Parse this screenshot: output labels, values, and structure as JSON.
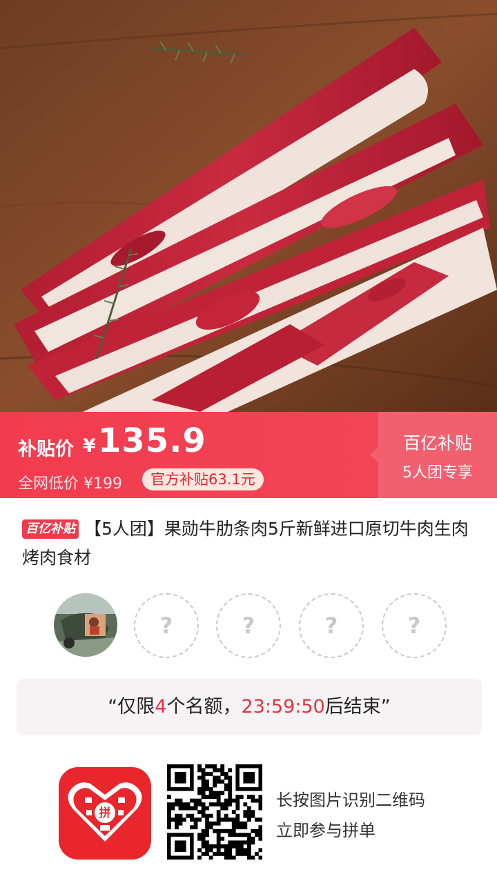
{
  "price_bar": {
    "label": "补贴价",
    "currency": "¥",
    "price": "135.9",
    "market_price": "全网低价 ¥199",
    "subsidy_pill": "官方补贴63.1元",
    "program_title": "百亿补贴",
    "program_subtitle": "5人团专享"
  },
  "product": {
    "badge": "百亿补贴",
    "title": "【5人团】果勋牛肋条肉5斤新鲜进口原切牛肉生肉烤肉食材"
  },
  "group": {
    "slots": [
      "?",
      "?",
      "?",
      "?"
    ]
  },
  "notice": {
    "prefix": "“仅限",
    "count": "4",
    "middle": "个名额，",
    "timer": "23:59:50",
    "suffix": "后结束”"
  },
  "footer": {
    "logo_char": "拼",
    "hint_line1": "长按图片识别二维码",
    "hint_line2": "立即参与拼单"
  },
  "colors": {
    "brand_red": "#f23b4e",
    "accent_red": "#e8303f",
    "logo_red": "#e9262b"
  }
}
